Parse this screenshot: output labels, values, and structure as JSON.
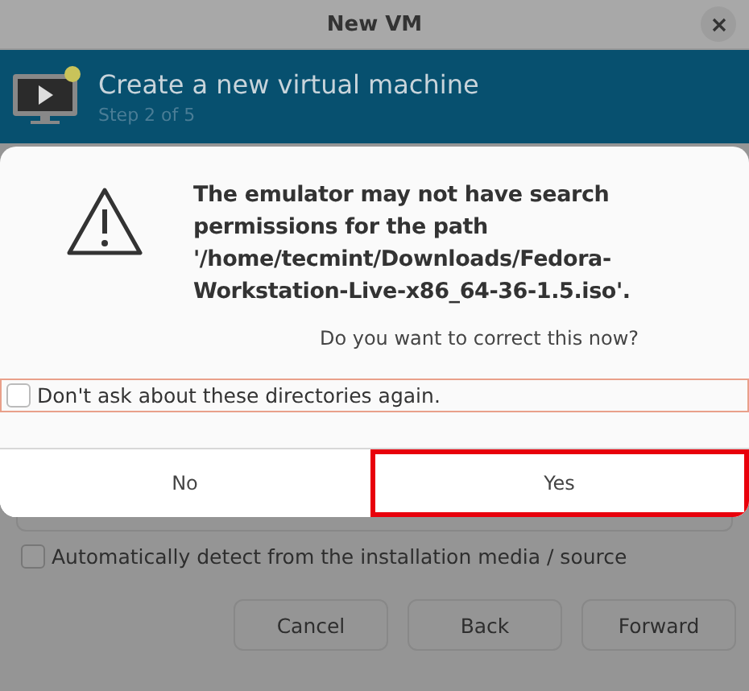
{
  "window": {
    "title": "New VM"
  },
  "banner": {
    "title": "Create a new virtual machine",
    "subtitle": "Step 2 of 5"
  },
  "dialog": {
    "message": "The emulator may not have search permissions for the path '/home/tecmint/Downloads/Fedora-Workstation-Live-x86_64-36-1.5.iso'.",
    "question": "Do you want to correct this now?",
    "checkbox": {
      "label": "Don't ask about these directories again.",
      "checked": false,
      "focused": true
    },
    "buttons": [
      {
        "label": "No",
        "highlighted": false
      },
      {
        "label": "Yes",
        "highlighted": true
      }
    ]
  },
  "auto_detect": {
    "label": "Automatically detect from the installation media / source",
    "checked": false
  },
  "buttons": [
    "Cancel",
    "Back",
    "Forward"
  ]
}
